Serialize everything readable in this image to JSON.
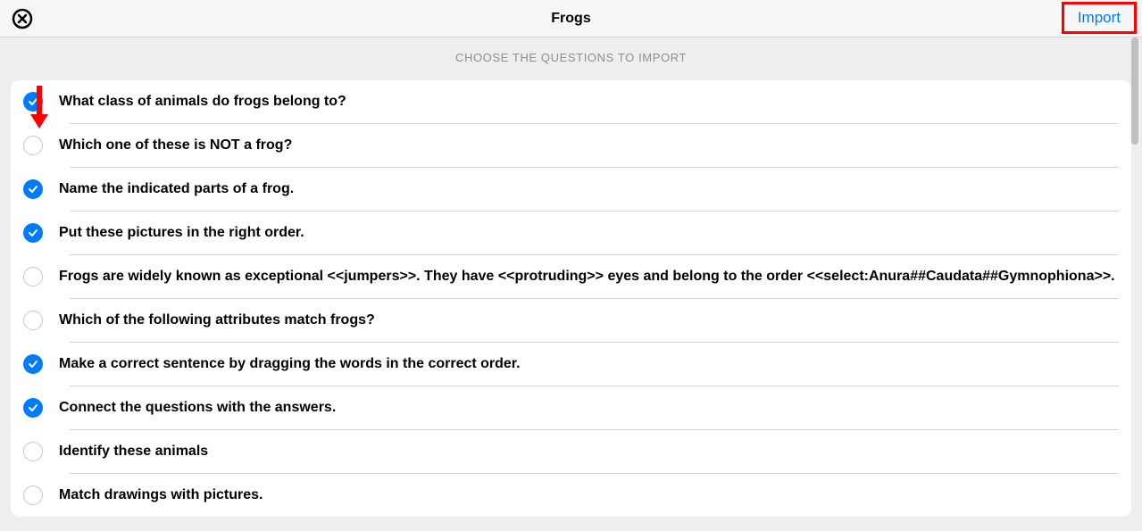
{
  "header": {
    "title": "Frogs",
    "import_label": "Import"
  },
  "subheader": {
    "text": "CHOOSE THE QUESTIONS TO IMPORT"
  },
  "questions": [
    {
      "text": "What class of animals do frogs belong to?",
      "checked": true
    },
    {
      "text": "Which one of these is NOT a frog?",
      "checked": false
    },
    {
      "text": "Name the indicated parts of a frog.",
      "checked": true
    },
    {
      "text": "Put these pictures in the right order.",
      "checked": true
    },
    {
      "text": "Frogs are widely known as exceptional <<jumpers>>. They have <<protruding>> eyes and belong to the order <<select:Anura##Caudata##Gymnophiona>>.",
      "checked": false
    },
    {
      "text": "Which of the following attributes match frogs?",
      "checked": false
    },
    {
      "text": "Make a correct sentence by dragging the words in the correct order.",
      "checked": true
    },
    {
      "text": "Connect the questions with the answers.",
      "checked": true
    },
    {
      "text": "Identify these animals",
      "checked": false
    },
    {
      "text": "Match drawings with pictures.",
      "checked": false
    }
  ]
}
